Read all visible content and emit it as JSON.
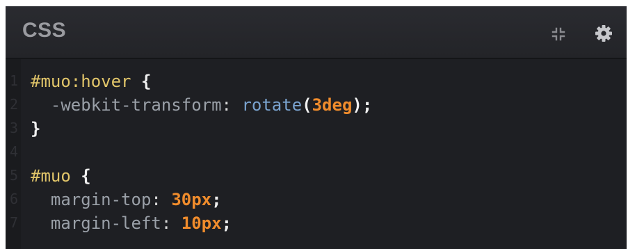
{
  "panel": {
    "title": "CSS",
    "icons": {
      "expand": "expand-icon",
      "settings": "gear-icon"
    }
  },
  "editor": {
    "line_numbers": [
      "1",
      "2",
      "3",
      "4",
      "5",
      "6",
      "7"
    ],
    "lines": [
      {
        "selector": "#muo:hover",
        "brace": "{"
      },
      {
        "property": "-webkit-transform",
        "colon": ":",
        "func": "rotate",
        "open": "(",
        "value": "3deg",
        "close": ")",
        "semi": ";"
      },
      {
        "brace": "}"
      },
      {},
      {
        "selector": "#muo",
        "brace": "{"
      },
      {
        "property": "margin-top",
        "colon": ":",
        "value": "30px",
        "semi": ";"
      },
      {
        "property": "margin-left",
        "colon": ":",
        "value": "10px",
        "semi": ";"
      }
    ]
  },
  "colors": {
    "background": "#1d1e22",
    "selector": "#e2c66a",
    "property": "#9aa0a8",
    "function": "#7aa3cf",
    "number": "#f08c2c"
  }
}
